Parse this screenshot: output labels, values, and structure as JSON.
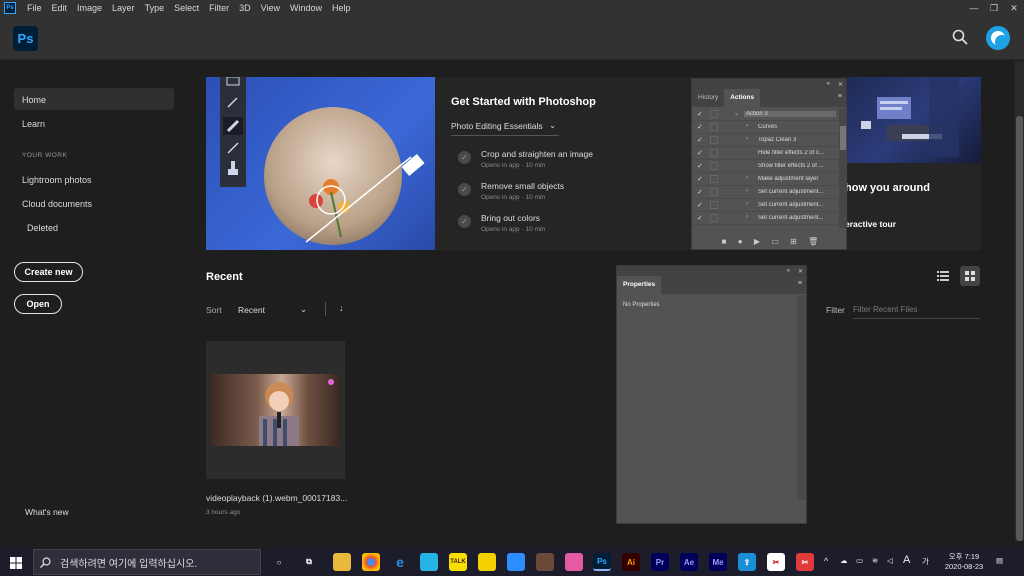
{
  "menubar": {
    "items": [
      "File",
      "Edit",
      "Image",
      "Layer",
      "Type",
      "Select",
      "Filter",
      "3D",
      "View",
      "Window",
      "Help"
    ],
    "app_icon": "Ps"
  },
  "header": {
    "logo": "Ps",
    "search_icon": "search-icon"
  },
  "sidebar": {
    "home": "Home",
    "learn": "Learn",
    "section": "YOUR WORK",
    "lightroom": "Lightroom photos",
    "cloud": "Cloud documents",
    "deleted": "Deleted",
    "create_new": "Create new",
    "open": "Open",
    "whats_new": "What's new"
  },
  "get_started": {
    "title": "Get Started with Photoshop",
    "dropdown": "Photo Editing Essentials",
    "tasks": [
      {
        "title": "Crop and straighten an image",
        "sub": "Opens in app · 10 min"
      },
      {
        "title": "Remove small objects",
        "sub": "Opens in app · 10 min"
      },
      {
        "title": "Bring out colors",
        "sub": "Opens in app · 10 min"
      }
    ],
    "right_title": "how you around",
    "right_link": "eractive tour"
  },
  "actions_panel": {
    "tabs": [
      "History",
      "Actions"
    ],
    "rows": [
      {
        "label": "Action 3",
        "expand": "⌄"
      },
      {
        "label": "Curves",
        "expand": "›"
      },
      {
        "label": "Topaz Clean 3",
        "expand": "›"
      },
      {
        "label": "Hide filter effects 2 of c...",
        "expand": ""
      },
      {
        "label": "Show filter effects 2 of ...",
        "expand": ""
      },
      {
        "label": "Make adjustment layer",
        "expand": "›"
      },
      {
        "label": "Set current adjustment...",
        "expand": "›"
      },
      {
        "label": "Set current adjustment...",
        "expand": "›"
      },
      {
        "label": "Set current adjustment...",
        "expand": "›"
      }
    ]
  },
  "properties_panel": {
    "title": "Properties",
    "empty": "No Properties"
  },
  "recent": {
    "title": "Recent",
    "sort_label": "Sort",
    "sort_value": "Recent",
    "filter_label": "Filter",
    "filter_placeholder": "Filter Recent Files",
    "files": [
      {
        "name": "videoplayback (1).webm_00017183...",
        "time": "3 hours ago"
      }
    ]
  },
  "taskbar": {
    "search_placeholder": "검색하려면 여기에 입력하십시오.",
    "time": "오후 7:19",
    "date": "2020-08-23",
    "ime": "A",
    "lang": "가"
  }
}
